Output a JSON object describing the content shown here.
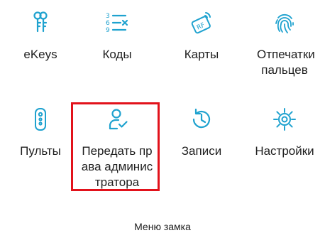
{
  "accent_color": "#1fa2cf",
  "highlight_color": "#e2121b",
  "menu_items": [
    {
      "label": "eKeys",
      "icon": "ekey-icon"
    },
    {
      "label": "Коды",
      "icon": "passcode-list-icon"
    },
    {
      "label": "Карты",
      "icon": "rf-card-icon"
    },
    {
      "label": "Отпечатки пальцев",
      "icon": "fingerprint-icon"
    },
    {
      "label": "Пульты",
      "icon": "remote-icon"
    },
    {
      "label": "Передать права администратора",
      "icon": "transfer-admin-icon",
      "highlighted": true
    },
    {
      "label": "Записи",
      "icon": "history-icon"
    },
    {
      "label": "Настройки",
      "icon": "settings-gear-icon"
    }
  ],
  "footer": {
    "caption": "Меню замка"
  }
}
